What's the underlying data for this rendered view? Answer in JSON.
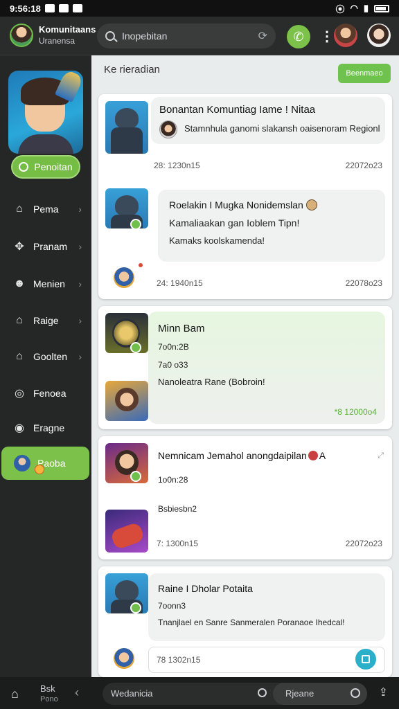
{
  "status_bar": {
    "time": "9:56:18"
  },
  "header": {
    "title": "Komunitaans",
    "subtitle": "Uranensa",
    "search_placeholder": "Inopebitan"
  },
  "sidebar": {
    "primary_button": "Penoitan",
    "items": [
      {
        "label": "Pema",
        "icon": "home-icon"
      },
      {
        "label": "Pranam",
        "icon": "puzzle-icon"
      },
      {
        "label": "Menien",
        "icon": "mask-icon"
      },
      {
        "label": "Raige",
        "icon": "house-icon"
      },
      {
        "label": "Goolten",
        "icon": "house-icon"
      },
      {
        "label": "Fenoea",
        "icon": "circle-icon"
      },
      {
        "label": "Eragne",
        "icon": "circle-icon"
      },
      {
        "label": "Paoba",
        "icon": "avatar-icon"
      }
    ]
  },
  "main": {
    "heading": "Ke rieradian",
    "action_button": "Beenmaeo",
    "cards": [
      {
        "title": "Bonantan Komuntiag Iame ! Nitaa",
        "text": "Stamnhula ganomi slakansh oaisenoram Regionl",
        "time": "28: 1230n15",
        "date": "22072o23"
      },
      {
        "title": "Roelakin I Mugka Nonidemslan",
        "line1": "Kamaliaakan gan Ioblem Tipn!",
        "line2": "Kamaks koolskamenda!",
        "time": "24: 1940n15",
        "date": "22078o23"
      },
      {
        "title": "Minn Bam",
        "line1": "7o0n:2B",
        "line2": "7a0 o33",
        "line3": "Nanoleatra Rane (Bobroin!",
        "time": "*8 12000o4"
      },
      {
        "title": "Nemnicam Jemahol anongdaipilan",
        "title_suffix": "A",
        "line1": "1o0n:28",
        "line2": "Bsbiesbn2",
        "time": "7: 1300n15",
        "date": "22072o23"
      },
      {
        "title": "Raine I Dholar Potaita",
        "line1": "7oonn3",
        "line2": "Tnanjlael en Sanre Sanmeralen Poranaoe Ihedcal!",
        "time": "78 1302n15"
      }
    ]
  },
  "bottom_bar": {
    "label": "Bsk",
    "sublabel": "Pono",
    "input_left": "Wedanicia",
    "input_right": "Rjeane"
  }
}
